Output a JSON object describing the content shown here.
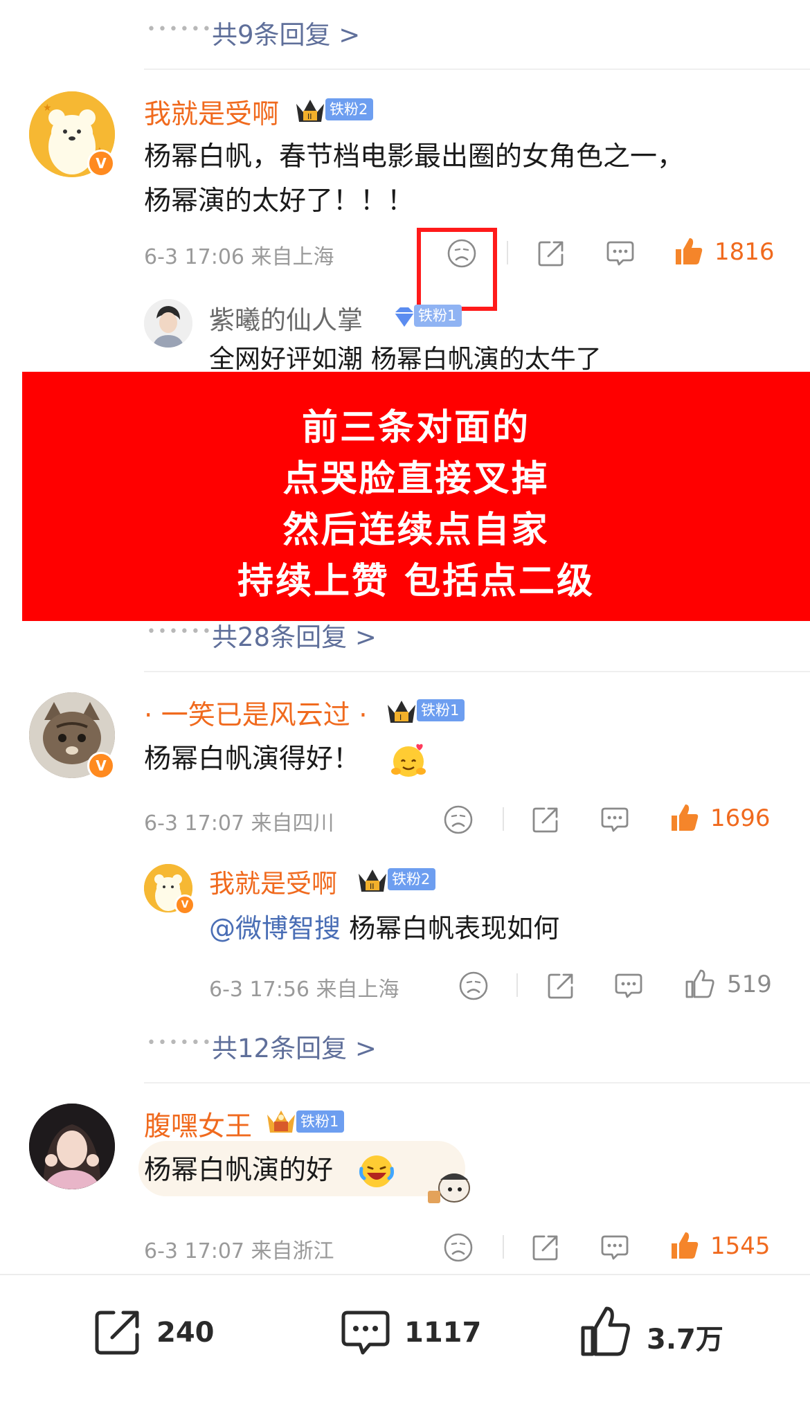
{
  "thread0": {
    "replies_label": "共9条回复 >"
  },
  "comments": [
    {
      "username": "我就是受啊",
      "fan_badge": "铁粉2",
      "text_line1": "杨幂白帆，春节档电影最出圈的女角色之一，",
      "text_line2": "杨幂演的太好了！！！",
      "meta": "6-3 17:06  来自上海",
      "likes": "1816",
      "reply": {
        "username": "紫曦的仙人掌",
        "fan_badge": "铁粉1",
        "text": "全网好评如潮 杨幂白帆演的太牛了"
      },
      "replies_label": "共28条回复 >"
    },
    {
      "username": "· 一笑已是风云过 ·",
      "fan_badge": "铁粉1",
      "text": "杨幂白帆演得好！",
      "meta": "6-3 17:07  来自四川",
      "likes": "1696",
      "reply": {
        "username": "我就是受啊",
        "fan_badge": "铁粉2",
        "mention": "@微博智搜",
        "text": " 杨幂白帆表现如何",
        "meta": "6-3 17:56  来自上海",
        "likes": "519"
      },
      "replies_label": "共12条回复 >"
    },
    {
      "username": "腹嘿女王",
      "fan_badge": "铁粉1",
      "text": "杨幂白帆演的好",
      "meta": "6-3 17:07  来自浙江",
      "likes": "1545"
    }
  ],
  "banner": {
    "line1": "前三条对面的",
    "line2": "点哭脸直接叉掉",
    "line3": "然后连续点自家",
    "line4": "持续上赞 包括点二级"
  },
  "bottom_bar": {
    "share_count": "240",
    "comment_count": "1117",
    "like_count": "3.7万"
  },
  "colors": {
    "accent_orange": "#f06a1e",
    "link_blue": "#5f6f9a",
    "badge_blue": "#6d9ef0",
    "banner_red": "#ff0000"
  }
}
